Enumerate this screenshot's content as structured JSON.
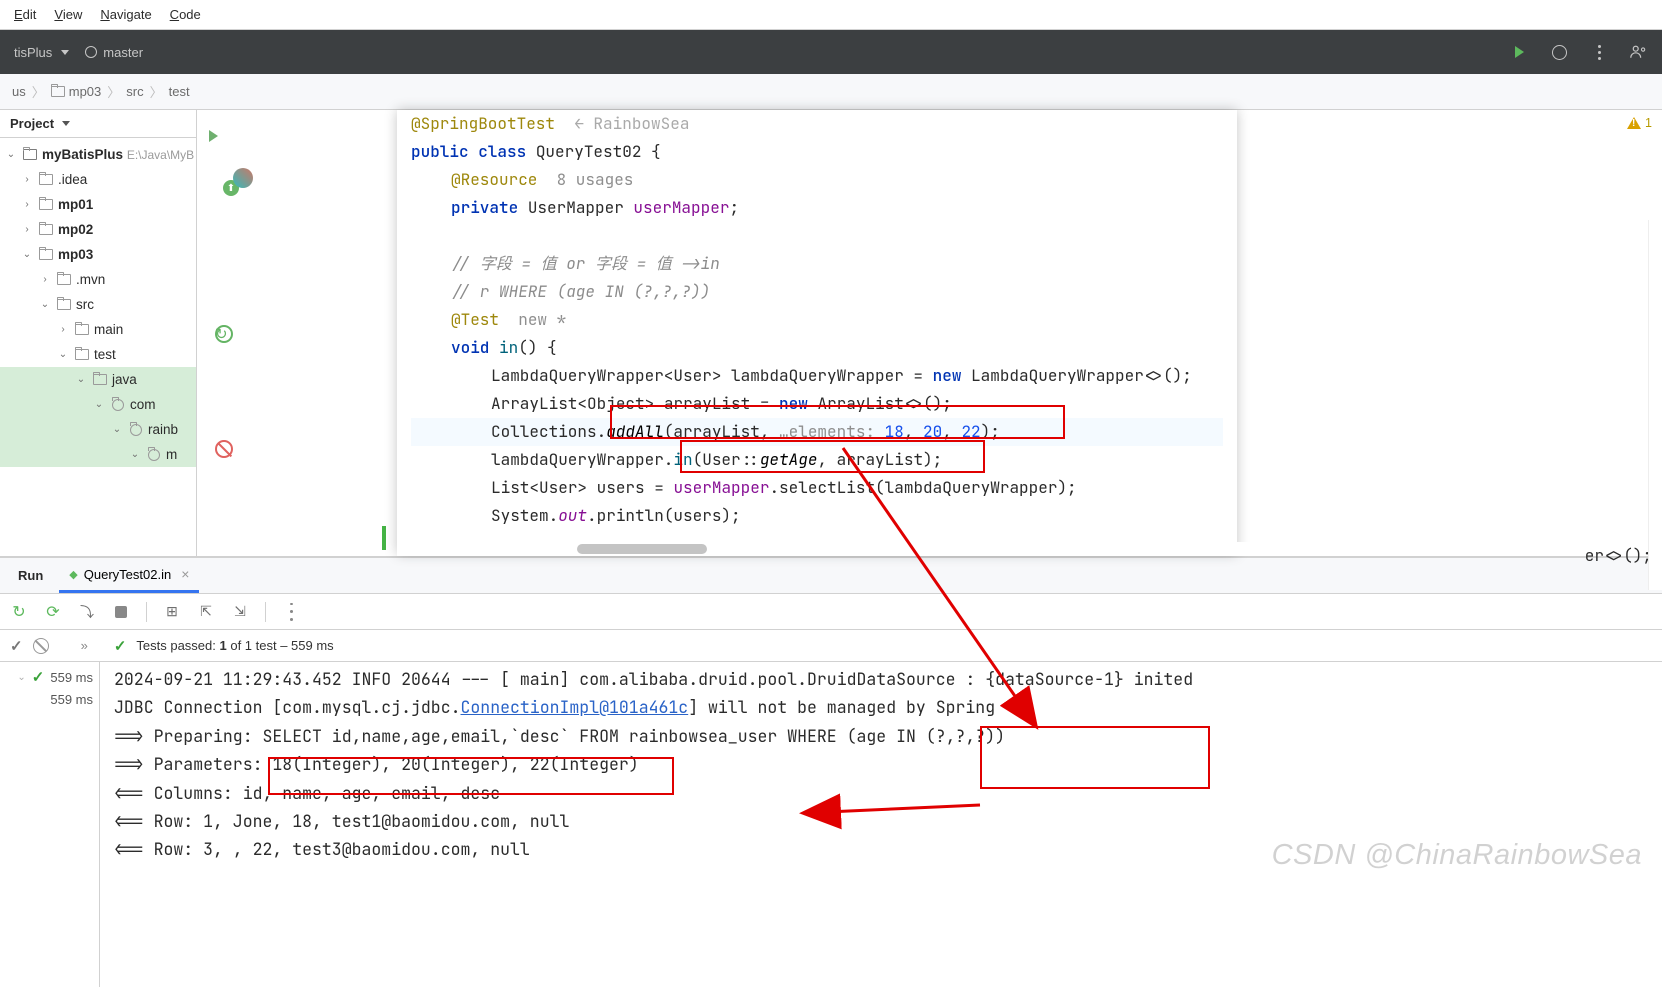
{
  "menu": {
    "edit": "Edit",
    "view": "View",
    "navigate": "Navigate",
    "code": "Code"
  },
  "toolbar": {
    "config": "tisPlus",
    "branch": "master"
  },
  "breadcrumb": {
    "seg0": "us",
    "seg1": "mp03",
    "seg2": "src",
    "seg3": "test",
    "sep": "〉"
  },
  "project": {
    "header": "Project",
    "root": "myBatisPlus",
    "root_path": "E:\\Java\\MyB",
    "idea": ".idea",
    "mp01": "mp01",
    "mp02": "mp02",
    "mp03": "mp03",
    "mvn": ".mvn",
    "src": "src",
    "main": "main",
    "test": "test",
    "java": "java",
    "com": "com",
    "rainb": "rainb",
    "m": "m"
  },
  "code": {
    "l1_pre": "public class ",
    "l1_cls": "QueryTest02",
    " l1_suf": " {",
    "l2_anno": "@Resource",
    "l2_usages": "8 usages",
    "l3_kw": "private ",
    "l3_type": "UserMapper ",
    "l3_field": "userMapper",
    "l3_semi": ";",
    "l4": "// 字段 = 值 or 字段 = 值 ->in",
    "l5": "// r WHERE (age IN (?,?,?))",
    "l6_anno": "@Test",
    "l6_hint": "new *",
    "l7_kw": "void ",
    "l7_name": "in",
    "l7_par": "() {",
    "l8_a": "LambdaQueryWrapper<",
    "l8_b": "User",
    "l8_c": "> lambdaQueryWrapper = ",
    "l8_new": "new ",
    "l8_d": "LambdaQueryWrapper<>();",
    "l9_a": "ArrayList<",
    "l9_b": "Object",
    "l9_c": "> arrayList = ",
    "l9_new": "new ",
    "l9_d": "ArrayList<>();",
    "l10_a": "Collections.",
    "l10_m": "addAll",
    "l10_b": "(arrayList, ",
    "l10_h": " …elements: ",
    "l10_n1": "18",
    "l10_c1": ", ",
    "l10_n2": "20",
    "l10_c2": ", ",
    "l10_n3": "22",
    "l10_end": ");",
    "l11_a": "lambdaQueryWrapper.",
    "l11_m": "in",
    "l11_b": "(",
    "l11_ref": "User",
    "l11_c": "::",
    "l11_g": "getAge",
    "l11_d": ", arrayList);",
    "l12_a": "List<",
    "l12_b": "User",
    "l12_c": "> users = ",
    "l12_f": "userMapper",
    "l12_d": ".selectList(lambdaQueryWrapper);",
    "l13_a": "System.",
    "l13_b": "out",
    "l13_c": ".println(users);",
    "l14": "}",
    "behind": "er<>();"
  },
  "problems": {
    "count": "1"
  },
  "bottom": {
    "run": "Run",
    "tab": "QueryTest02.in",
    "passed_lead": "Tests passed: ",
    "passed_n": "1",
    "passed_tail": " of 1 test – 559 ms",
    "t1": "559 ms",
    "t2": "559 ms"
  },
  "console": {
    "l1": "2024-09-21 11:29:43.452  INFO 20644 --- [           main] com.alibaba.druid.pool.DruidDataSource   : {dataSource-1} inited",
    "l2a": "JDBC Connection [com.mysql.cj.jdbc.",
    "l2b": "ConnectionImpl@101a461c",
    "l2c": "] will not be managed by Spring",
    "l3a": "==>  Preparing: SELECT id,name,age,email,`desc` FROM rainbowsea_user WHERE",
    "l3b": " (age IN (?,?,?))",
    "l4a": "==> Parameters: ",
    "l4b": "18(Integer), 20(Integer), 22(Integer)",
    "l5": "<==    Columns: id, name, age, email, desc",
    "l6": "<==        Row: 1, Jone, 18, test1@baomidou.com, null",
    "l7": "<==        Row: 3, , 22, test3@baomidou.com, null"
  },
  "watermark": "CSDN @ChinaRainbowSea"
}
